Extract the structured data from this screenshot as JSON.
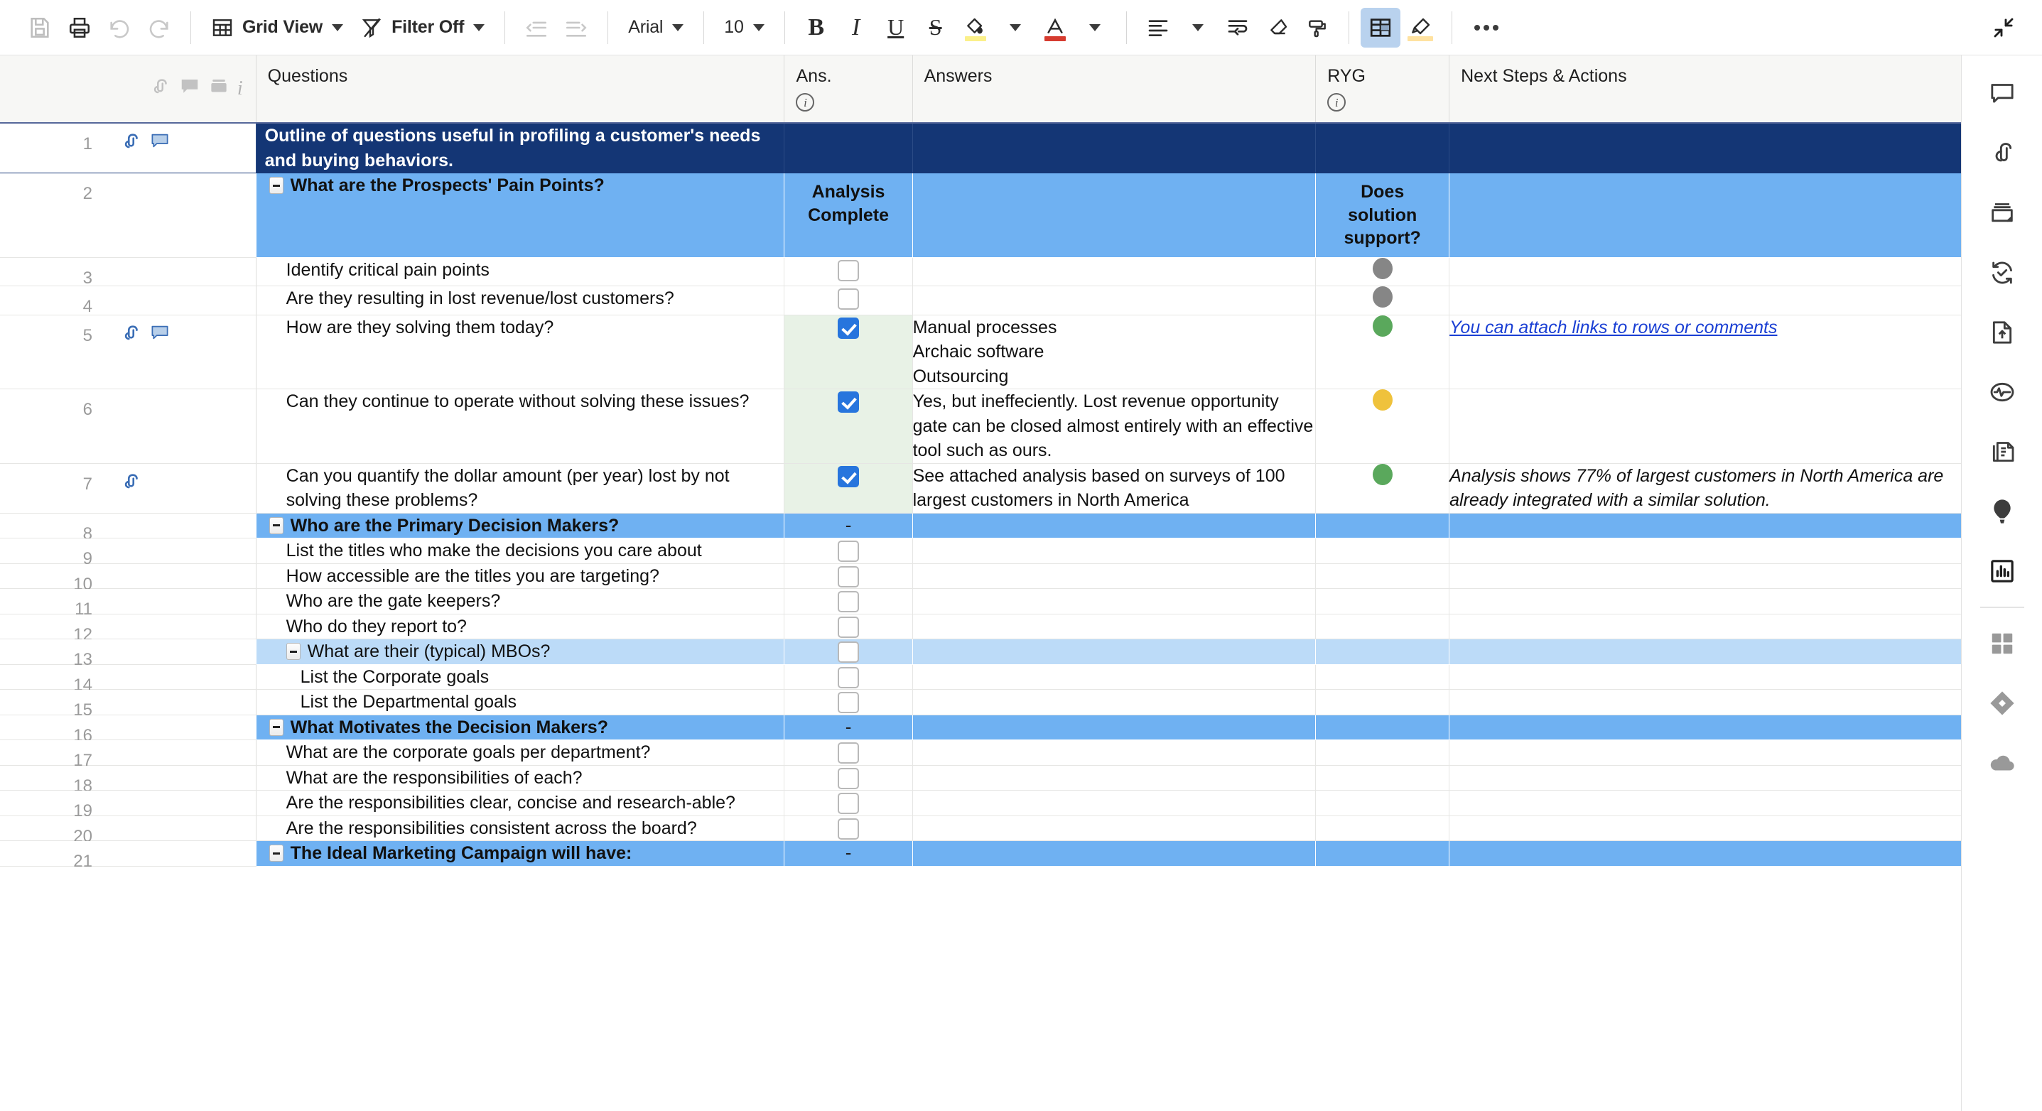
{
  "toolbar": {
    "save_label": "Save",
    "print_label": "Print",
    "undo_label": "Undo",
    "redo_label": "Redo",
    "view_label": "Grid View",
    "filter_label": "Filter Off",
    "indent_left_label": "Decrease Indent",
    "indent_right_label": "Increase Indent",
    "font_family": "Arial",
    "font_size": "10",
    "bold_label": "B",
    "italic_label": "I",
    "underline_label": "U",
    "strike_label": "S",
    "fill_color": "#fbf08a",
    "font_color": "#d63b2f",
    "align_label": "Align",
    "wrap_label": "Wrap Text",
    "clear_format_label": "Clear Formatting",
    "format_painter_label": "Format Painter",
    "grid_toggle_label": "Show/Hide",
    "highlight_color": "#ffe2a0",
    "more_label": "More Options",
    "collapse_label": "Collapse"
  },
  "columns": [
    {
      "key": "gutter",
      "label": ""
    },
    {
      "key": "questions",
      "label": "Questions",
      "has_info": false
    },
    {
      "key": "ans",
      "label": "Ans.",
      "has_info": true
    },
    {
      "key": "answers",
      "label": "Answers",
      "has_info": false
    },
    {
      "key": "ryg",
      "label": "RYG",
      "has_info": true
    },
    {
      "key": "next",
      "label": "Next Steps & Actions",
      "has_info": false
    }
  ],
  "colors": {
    "navy": "#143675",
    "blue": "#6fb1f2",
    "light_blue": "#bcdbf8",
    "green_ball": "#5aa85c",
    "yellow_ball": "#efc23c",
    "gray_ball": "#868686",
    "checked_tint": "#e8f2e6",
    "link": "#1a3fd4",
    "accent_checkbox": "#2775dd"
  },
  "rows": [
    {
      "num": "1",
      "tint": "navy",
      "indent": 0,
      "bold": true,
      "collapse": false,
      "icons": [
        "attachment-icon",
        "comment-icon"
      ],
      "question": "Outline of questions useful in profiling a customer's needs and buying behaviors.",
      "ans": "",
      "ans_state": "none",
      "answers": "",
      "ryg": "",
      "next": "",
      "next_style": "none"
    },
    {
      "num": "2",
      "tint": "blue",
      "indent": 1,
      "bold": true,
      "collapse": true,
      "icons": [],
      "question": "What are the Prospects' Pain Points?",
      "ans": "Analysis Complete",
      "ans_state": "text",
      "answers": "",
      "ryg": "Does solution support?",
      "ryg_state": "text",
      "next": "",
      "next_style": "none"
    },
    {
      "num": "3",
      "tint": "none",
      "indent": 2,
      "bold": false,
      "collapse": false,
      "icons": [],
      "question": "Identify critical pain points",
      "ans": "",
      "ans_state": "unchecked",
      "answers": "",
      "ryg": "gray",
      "ryg_state": "ball",
      "next": "",
      "next_style": "none"
    },
    {
      "num": "4",
      "tint": "none",
      "indent": 2,
      "bold": false,
      "collapse": false,
      "icons": [],
      "question": "Are they resulting in lost revenue/lost customers?",
      "ans": "",
      "ans_state": "unchecked",
      "answers": "",
      "ryg": "gray",
      "ryg_state": "ball",
      "next": "",
      "next_style": "none"
    },
    {
      "num": "5",
      "tint": "none",
      "indent": 2,
      "bold": false,
      "collapse": false,
      "icons": [
        "attachment-icon",
        "comment-icon"
      ],
      "question": "How are they solving them today?",
      "ans": "",
      "ans_state": "checked",
      "answers": "Manual processes\nArchaic software\nOutsourcing",
      "ryg": "green",
      "ryg_state": "ball",
      "next": "You can attach links to rows or comments",
      "next_style": "link"
    },
    {
      "num": "6",
      "tint": "none",
      "indent": 2,
      "bold": false,
      "collapse": false,
      "icons": [],
      "question": "Can they continue to operate without solving these issues?",
      "ans": "",
      "ans_state": "checked",
      "answers": "Yes, but ineffeciently. Lost revenue opportunity gate can be closed almost entirely with an effective tool such as ours.",
      "ryg": "yellow",
      "ryg_state": "ball",
      "next": "",
      "next_style": "none"
    },
    {
      "num": "7",
      "tint": "none",
      "indent": 2,
      "bold": false,
      "collapse": false,
      "icons": [
        "attachment-icon"
      ],
      "question": "Can you quantify the dollar amount (per year) lost by not solving these problems?",
      "ans": "",
      "ans_state": "checked",
      "answers": "See attached analysis based on surveys of 100 largest customers in North America",
      "ryg": "green",
      "ryg_state": "ball",
      "next": "Analysis shows 77% of largest customers in North America are already integrated with a similar solution.",
      "next_style": "italic"
    },
    {
      "num": "8",
      "tint": "blue",
      "indent": 1,
      "bold": true,
      "collapse": true,
      "icons": [],
      "question": "Who are the Primary Decision Makers?",
      "ans": "-",
      "ans_state": "dash",
      "answers": "",
      "ryg": "",
      "ryg_state": "none",
      "next": "",
      "next_style": "none"
    },
    {
      "num": "9",
      "tint": "none",
      "indent": 2,
      "bold": false,
      "collapse": false,
      "icons": [],
      "question": "List the titles who make the decisions you care about",
      "ans": "",
      "ans_state": "unchecked",
      "answers": "",
      "ryg": "",
      "ryg_state": "none",
      "next": "",
      "next_style": "none"
    },
    {
      "num": "10",
      "tint": "none",
      "indent": 2,
      "bold": false,
      "collapse": false,
      "icons": [],
      "question": "How accessible are the titles you are targeting?",
      "ans": "",
      "ans_state": "unchecked",
      "answers": "",
      "ryg": "",
      "ryg_state": "none",
      "next": "",
      "next_style": "none"
    },
    {
      "num": "11",
      "tint": "none",
      "indent": 2,
      "bold": false,
      "collapse": false,
      "icons": [],
      "question": "Who are the gate keepers?",
      "ans": "",
      "ans_state": "unchecked",
      "answers": "",
      "ryg": "",
      "ryg_state": "none",
      "next": "",
      "next_style": "none"
    },
    {
      "num": "12",
      "tint": "none",
      "indent": 2,
      "bold": false,
      "collapse": false,
      "icons": [],
      "question": "Who do they report to?",
      "ans": "",
      "ans_state": "unchecked",
      "answers": "",
      "ryg": "",
      "ryg_state": "none",
      "next": "",
      "next_style": "none"
    },
    {
      "num": "13",
      "tint": "lightblue",
      "indent": 2,
      "bold": false,
      "collapse": true,
      "icons": [],
      "question": "What are their (typical) MBOs?",
      "ans": "",
      "ans_state": "unchecked",
      "answers": "",
      "ryg": "",
      "ryg_state": "none",
      "next": "",
      "next_style": "none"
    },
    {
      "num": "14",
      "tint": "none",
      "indent": 3,
      "bold": false,
      "collapse": false,
      "icons": [],
      "question": "List the Corporate goals",
      "ans": "",
      "ans_state": "unchecked",
      "answers": "",
      "ryg": "",
      "ryg_state": "none",
      "next": "",
      "next_style": "none"
    },
    {
      "num": "15",
      "tint": "none",
      "indent": 3,
      "bold": false,
      "collapse": false,
      "icons": [],
      "question": "List the Departmental goals",
      "ans": "",
      "ans_state": "unchecked",
      "answers": "",
      "ryg": "",
      "ryg_state": "none",
      "next": "",
      "next_style": "none"
    },
    {
      "num": "16",
      "tint": "blue",
      "indent": 1,
      "bold": true,
      "collapse": true,
      "icons": [],
      "question": "What Motivates the Decision Makers?",
      "ans": "-",
      "ans_state": "dash",
      "answers": "",
      "ryg": "",
      "ryg_state": "none",
      "next": "",
      "next_style": "none"
    },
    {
      "num": "17",
      "tint": "none",
      "indent": 2,
      "bold": false,
      "collapse": false,
      "icons": [],
      "question": "What are the corporate goals per department?",
      "ans": "",
      "ans_state": "unchecked",
      "answers": "",
      "ryg": "",
      "ryg_state": "none",
      "next": "",
      "next_style": "none"
    },
    {
      "num": "18",
      "tint": "none",
      "indent": 2,
      "bold": false,
      "collapse": false,
      "icons": [],
      "question": "What are the responsibilities of each?",
      "ans": "",
      "ans_state": "unchecked",
      "answers": "",
      "ryg": "",
      "ryg_state": "none",
      "next": "",
      "next_style": "none"
    },
    {
      "num": "19",
      "tint": "none",
      "indent": 2,
      "bold": false,
      "collapse": false,
      "icons": [],
      "question": "Are the responsibilities clear, concise and research-able?",
      "ans": "",
      "ans_state": "unchecked",
      "answers": "",
      "ryg": "",
      "ryg_state": "none",
      "next": "",
      "next_style": "none"
    },
    {
      "num": "20",
      "tint": "none",
      "indent": 2,
      "bold": false,
      "collapse": false,
      "icons": [],
      "question": "Are the responsibilities consistent across the board?",
      "ans": "",
      "ans_state": "unchecked",
      "answers": "",
      "ryg": "",
      "ryg_state": "none",
      "next": "",
      "next_style": "none"
    },
    {
      "num": "21",
      "tint": "blue",
      "indent": 1,
      "bold": true,
      "collapse": true,
      "icons": [],
      "question": "The Ideal Marketing Campaign will have:",
      "ans": "-",
      "ans_state": "dash",
      "answers": "",
      "ryg": "",
      "ryg_state": "none",
      "next": "",
      "next_style": "none"
    }
  ],
  "rail": [
    {
      "name": "conversations-icon",
      "label": "Conversations"
    },
    {
      "name": "attachments-icon",
      "label": "Attachments"
    },
    {
      "name": "proofs-icon",
      "label": "Proofs"
    },
    {
      "name": "update-requests-icon",
      "label": "Update Requests"
    },
    {
      "name": "publish-icon",
      "label": "Publish"
    },
    {
      "name": "activity-log-icon",
      "label": "Activity Log"
    },
    {
      "name": "summary-icon",
      "label": "Sheet Summary"
    },
    {
      "name": "balloon-icon",
      "label": "Learning Center"
    },
    {
      "name": "chart-icon",
      "label": "Charts"
    },
    {
      "name": "apps-grid-icon",
      "label": "Apps"
    },
    {
      "name": "diamond-icon",
      "label": "Premium App"
    },
    {
      "name": "cloud-icon",
      "label": "Cloud"
    }
  ]
}
